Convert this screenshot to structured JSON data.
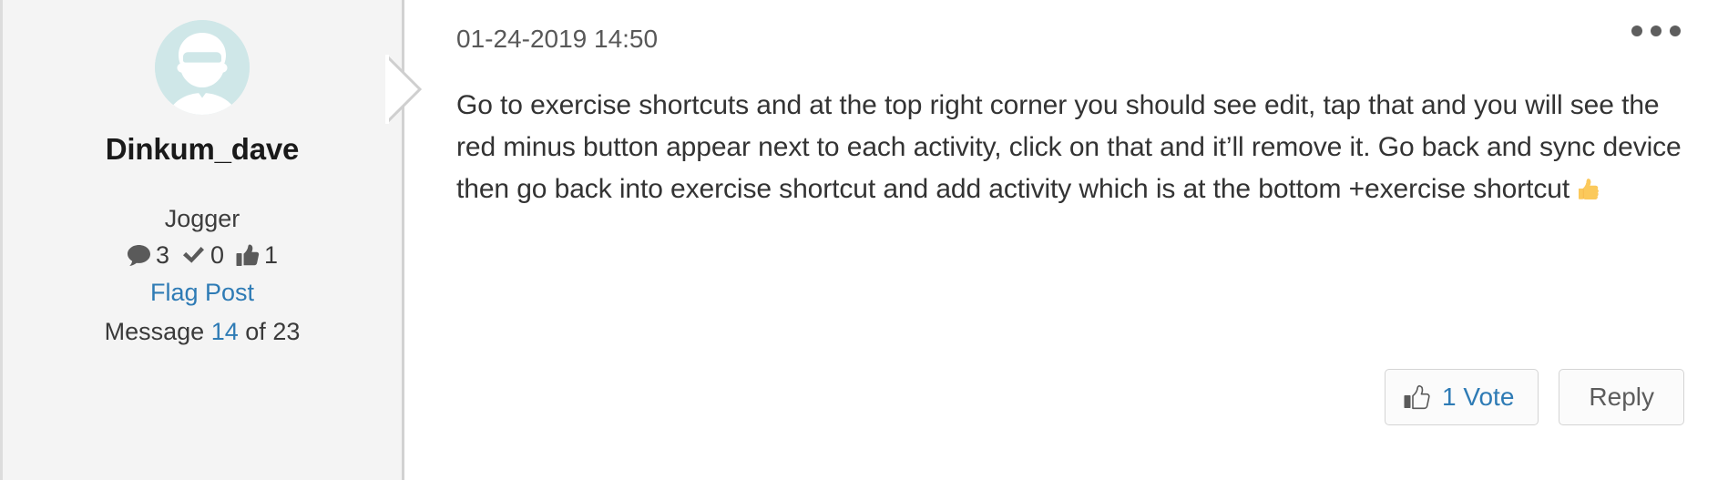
{
  "colors": {
    "sidebar_bg": "#f4f4f4",
    "link_blue": "#2e7bb5",
    "body_text": "#333333",
    "muted_text": "#585858",
    "avatar_bg": "#cfe7e8",
    "border": "#d4d4d4",
    "emoji_yellow": "#f5bf4b"
  },
  "sidebar": {
    "avatar_icon": "user-avatar-placeholder-icon",
    "author_name": "Dinkum_dave",
    "rank": "Jogger",
    "stats": [
      {
        "icon": "comment-bubble-icon",
        "value": "3"
      },
      {
        "icon": "checkmark-icon",
        "value": "0"
      },
      {
        "icon": "thumbs-up-icon",
        "value": "1"
      }
    ],
    "flag_post_label": "Flag Post",
    "message_counter": {
      "prefix": "Message",
      "index": "14",
      "middle": "of",
      "total": "23"
    }
  },
  "post": {
    "timestamp": "01-24-2019 14:50",
    "menu_icon": "more-options-ellipsis-icon",
    "body": "Go to exercise shortcuts and at the top right corner you should see edit, tap that and you will see the red minus button appear next to each activity, click on that and it’ll remove it. Go back and sync device then go back into exercise shortcut and add activity which is at the bottom +exercise shortcut ",
    "body_emoji": "thumbs-up-emoji"
  },
  "actions": {
    "vote_icon": "thumbs-up-outline-icon",
    "vote_label": "1 Vote",
    "reply_label": "Reply"
  }
}
